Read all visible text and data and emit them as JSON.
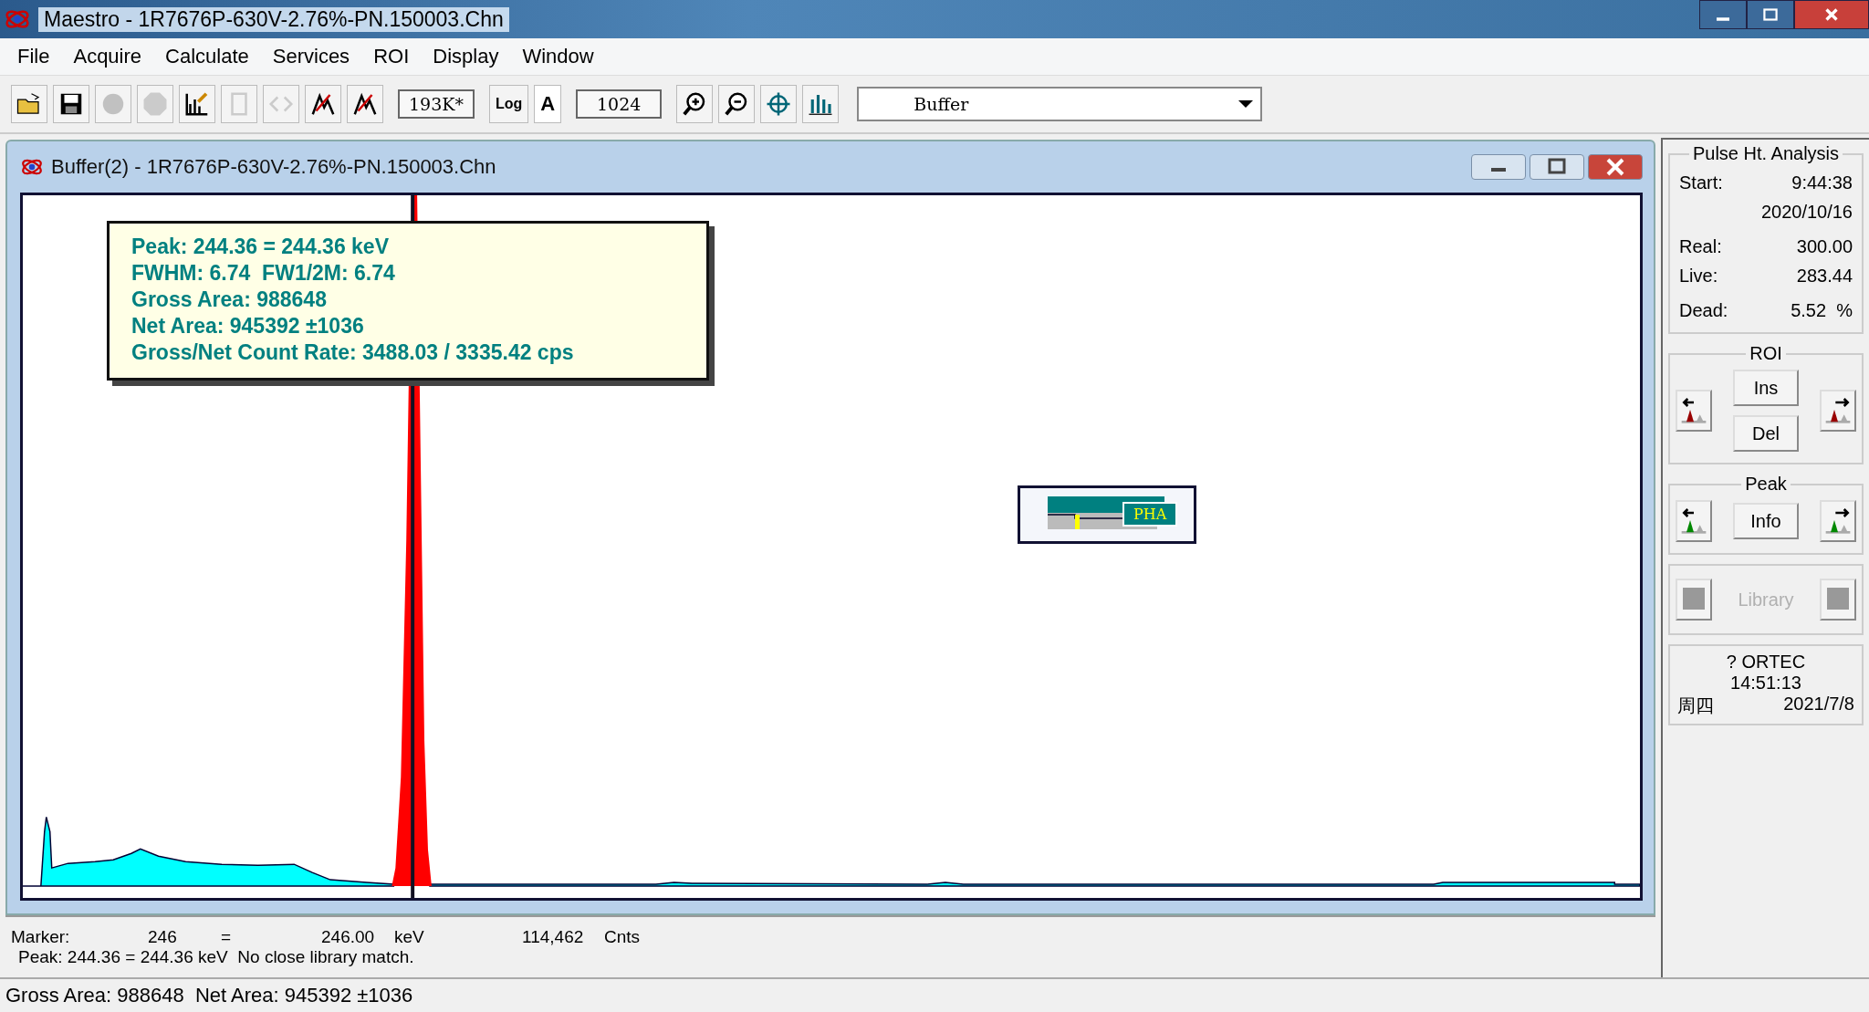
{
  "window": {
    "title": "Maestro - 1R7676P-630V-2.76%-PN.150003.Chn"
  },
  "menu": [
    "File",
    "Acquire",
    "Calculate",
    "Services",
    "ROI",
    "Display",
    "Window"
  ],
  "toolbar": {
    "icons_left": [
      {
        "kind": "open",
        "disabled": false
      },
      {
        "kind": "save",
        "disabled": false
      },
      {
        "kind": "start",
        "disabled": true
      },
      {
        "kind": "stop",
        "disabled": true
      },
      {
        "kind": "chart",
        "disabled": false
      },
      {
        "kind": "page",
        "disabled": true
      },
      {
        "kind": "arrows",
        "disabled": true
      },
      {
        "kind": "marker",
        "disabled": false
      },
      {
        "kind": "marker",
        "disabled": false
      }
    ],
    "memory": "193K*",
    "log_button": "Log",
    "auto_button": "A",
    "scale_field": "1024",
    "icons_right": [
      {
        "kind": "zoom-in",
        "disabled": false
      },
      {
        "kind": "zoom-out",
        "disabled": false
      },
      {
        "kind": "target",
        "disabled": false
      },
      {
        "kind": "bars",
        "disabled": false
      }
    ],
    "buffer_select": "Buffer"
  },
  "spectrum_window": {
    "title": "Buffer(2) - 1R7676P-630V-2.76%-PN.150003.Chn",
    "peak_info": [
      "Peak: 244.36 = 244.36 keV",
      "FWHM: 6.74  FW1/2M: 6.74",
      "Gross Area: 988648",
      "Net Area: 945392 ±1036",
      "Gross/Net Count Rate: 3488.03 / 3335.42 cps"
    ],
    "pha_badge": "PHA"
  },
  "marker_bar": {
    "marker_label": "Marker:",
    "channel": "246",
    "equals": "=",
    "energy": "246.00",
    "energy_unit": "keV",
    "counts": "114,462",
    "counts_unit": "Cnts",
    "peak_line": "Peak: 244.36 = 244.36 keV  No close library match."
  },
  "status_bar": "Gross Area: 988648  Net Area: 945392 ±1036",
  "side_panel": {
    "pha": {
      "title": "Pulse Ht. Analysis",
      "rows": [
        {
          "label": "Start:",
          "value": "9:44:38"
        },
        {
          "label": "",
          "value": "2020/10/16"
        },
        {
          "label": "Real:",
          "value": "300.00"
        },
        {
          "label": "Live:",
          "value": "283.44"
        },
        {
          "label": "Dead:",
          "value": "5.52  %"
        }
      ]
    },
    "roi": {
      "title": "ROI",
      "buttons": [
        "Ins",
        "Del"
      ]
    },
    "peak": {
      "title": "Peak",
      "button": "Info"
    },
    "library": {
      "label": "Library",
      "disabled": true
    },
    "clock": {
      "brand": "? ORTEC",
      "time": "14:51:13",
      "weekday": "周四",
      "date": "2021/7/8"
    }
  }
}
